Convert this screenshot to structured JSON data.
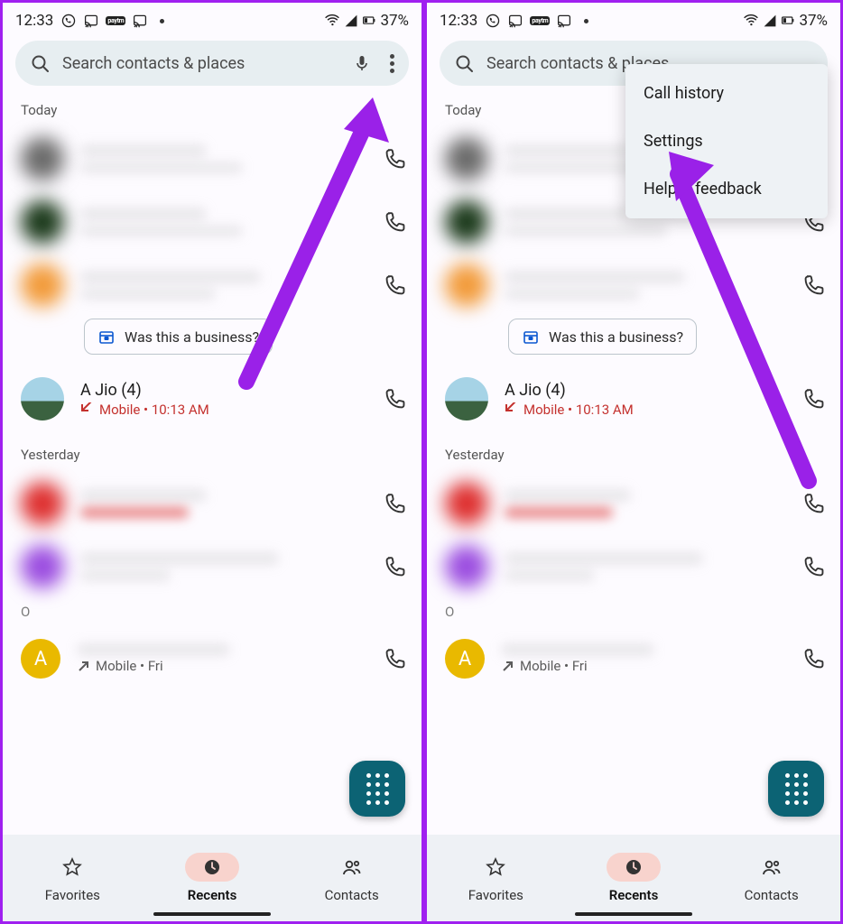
{
  "status": {
    "time": "12:33",
    "battery": "37%"
  },
  "search": {
    "placeholder": "Search contacts & places"
  },
  "sections": {
    "today": "Today",
    "yesterday": "Yesterday",
    "older": "O"
  },
  "chip": {
    "label": "Was this a business?"
  },
  "calls": {
    "ajio_name": "A Jio  (4)",
    "ajio_sub": "Mobile • 10:13 AM",
    "outgoing_sub": "Mobile • Fri"
  },
  "nav": {
    "favorites": "Favorites",
    "recents": "Recents",
    "contacts": "Contacts"
  },
  "menu": {
    "call_history": "Call history",
    "settings": "Settings",
    "help": "Help & feedback"
  }
}
